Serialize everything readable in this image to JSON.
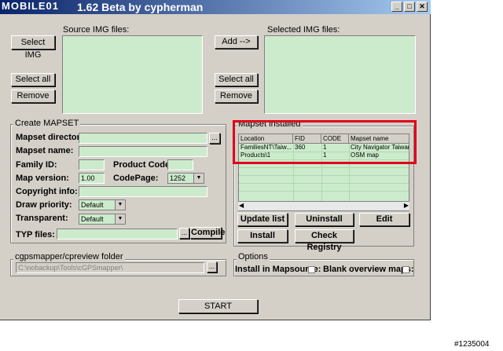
{
  "window": {
    "title": "1.62 Beta by cypherman",
    "watermark_logo": "MOBILE01"
  },
  "source_files": {
    "label": "Source IMG files:"
  },
  "selected_files": {
    "label": "Selected IMG files:"
  },
  "buttons": {
    "select_img": "Select IMG",
    "select_all_left": "Select all",
    "remove_left": "Remove",
    "add": "Add -->",
    "select_all_right": "Select all",
    "remove_right": "Remove",
    "browse": "...",
    "compile": "Compile",
    "update_list": "Update list",
    "uninstall": "Uninstall",
    "edit": "Edit",
    "install": "Install",
    "check_registry": "Check Registry",
    "start": "START"
  },
  "create_mapset": {
    "title": "Create MAPSET",
    "mapset_directory": "Mapset directory:",
    "mapset_name": "Mapset name:",
    "family_id": "Family ID:",
    "product_code": "Product Code:",
    "map_version": "Map version:",
    "map_version_value": "1.00",
    "codepage": "CodePage:",
    "codepage_value": "1252",
    "copyright_info": "Copyright info:",
    "draw_priority": "Draw priority:",
    "draw_priority_value": "Default",
    "transparent": "Transparent:",
    "transparent_value": "Default",
    "typ_files": "TYP files:"
  },
  "mapset_installed": {
    "title": "Mapset installed",
    "columns": [
      "Location",
      "FID",
      "CODE",
      "Mapset name"
    ],
    "rows": [
      [
        "FamiliesNT\\Taiw...",
        "360",
        "1",
        "City Navigator Taiwan N"
      ],
      [
        "Products\\1",
        "",
        "1",
        "OSM map"
      ]
    ]
  },
  "cgpsmapper": {
    "title": "cgpsmapper/cpreview folder",
    "path": "C:\\nobackup\\Tools\\cGPSmapper\\"
  },
  "options": {
    "title": "Options",
    "install_in_mapsource": "Install in Mapsource:",
    "blank_overview_maps": "Blank overview maps:"
  },
  "image_id": "#1235004"
}
